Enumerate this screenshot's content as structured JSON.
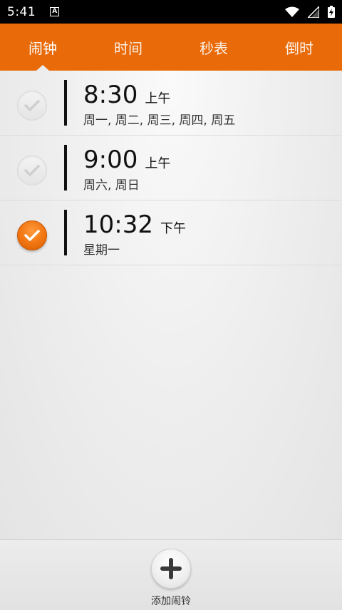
{
  "status_bar": {
    "time": "5:41",
    "notification_icon": "A"
  },
  "tabs": [
    {
      "label": "闹钟",
      "active": true
    },
    {
      "label": "时间",
      "active": false
    },
    {
      "label": "秒表",
      "active": false
    },
    {
      "label": "倒时",
      "active": false
    }
  ],
  "alarms": [
    {
      "time": "8:30",
      "ampm": "上午",
      "days": "周一, 周二, 周三, 周四, 周五",
      "enabled": false
    },
    {
      "time": "9:00",
      "ampm": "上午",
      "days": "周六, 周日",
      "enabled": false
    },
    {
      "time": "10:32",
      "ampm": "下午",
      "days": "星期一",
      "enabled": true
    }
  ],
  "bottom": {
    "add_label": "添加闹铃"
  },
  "colors": {
    "accent": "#e96a09",
    "check_on": "#f07410"
  }
}
